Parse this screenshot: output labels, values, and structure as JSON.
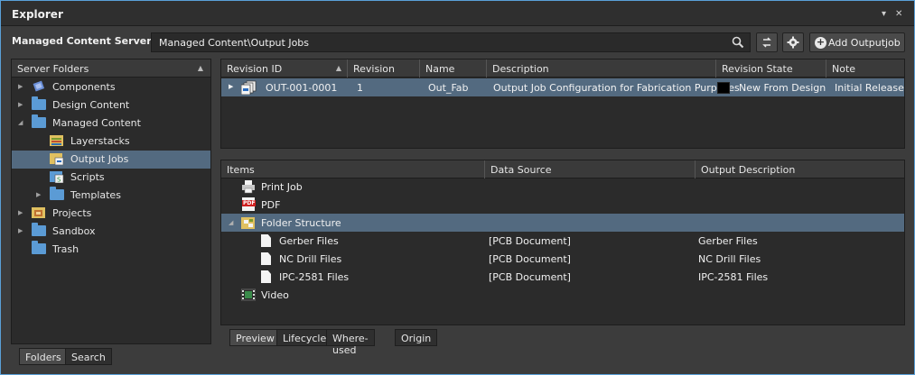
{
  "window": {
    "title": "Explorer",
    "pin_glyph": "▾",
    "close_glyph": "✕"
  },
  "toolbar": {
    "server_label": "Managed Content Server",
    "path_value": "Managed Content\\Output Jobs",
    "add_label": "Add Outputjob"
  },
  "left_panel": {
    "header": "Server Folders",
    "tree": [
      {
        "label": "Components",
        "icon": "components-icon",
        "expander": "▶",
        "level": 0
      },
      {
        "label": "Design Content",
        "icon": "folder-icon",
        "expander": "▶",
        "level": 0
      },
      {
        "label": "Managed Content",
        "icon": "folder-icon",
        "expander": "◢",
        "level": 0
      },
      {
        "label": "Layerstacks",
        "icon": "layerstack-folder-icon",
        "expander": "",
        "level": 1
      },
      {
        "label": "Output Jobs",
        "icon": "outputjob-folder-icon",
        "expander": "",
        "level": 1,
        "selected": true
      },
      {
        "label": "Scripts",
        "icon": "scripts-folder-icon",
        "expander": "",
        "level": 1
      },
      {
        "label": "Templates",
        "icon": "folder-icon",
        "expander": "▶",
        "level": 1
      },
      {
        "label": "Projects",
        "icon": "projects-folder-icon",
        "expander": "▶",
        "level": 0
      },
      {
        "label": "Sandbox",
        "icon": "folder-icon",
        "expander": "▶",
        "level": 0
      },
      {
        "label": "Trash",
        "icon": "folder-icon",
        "expander": "",
        "level": 0
      }
    ],
    "tabs": [
      "Folders",
      "Search"
    ]
  },
  "revisions": {
    "columns": [
      "Revision ID",
      "Revision",
      "Name",
      "Description",
      "Revision State",
      "Note"
    ],
    "row": {
      "revision_id": "OUT-001-0001",
      "revision": "1",
      "name": "Out_Fab",
      "description": "Output Job Configuration for Fabrication Purposes",
      "state": "New From Design",
      "note": "Initial Release",
      "state_color": "#000000"
    }
  },
  "items": {
    "columns": [
      "Items",
      "Data Source",
      "Output Description"
    ],
    "rows": [
      {
        "label": "Print Job",
        "source": "",
        "output": "",
        "icon": "printer-icon"
      },
      {
        "label": "PDF",
        "source": "",
        "output": "",
        "icon": "pdf-icon"
      },
      {
        "label": "Folder Structure",
        "source": "",
        "output": "",
        "icon": "folder-structure-icon",
        "expander": "◢"
      },
      {
        "label": "Gerber Files",
        "source": "[PCB Document]",
        "output": "Gerber Files",
        "icon": "document-icon"
      },
      {
        "label": "NC Drill Files",
        "source": "[PCB Document]",
        "output": "NC Drill Files",
        "icon": "document-icon"
      },
      {
        "label": "IPC-2581 Files",
        "source": "[PCB Document]",
        "output": "IPC-2581 Files",
        "icon": "document-icon"
      },
      {
        "label": "Video",
        "source": "",
        "output": "",
        "icon": "video-icon"
      }
    ],
    "tabs": [
      "Preview",
      "Lifecycle",
      "Where-used",
      "Origin"
    ]
  },
  "colors": {
    "selection": "#536a80",
    "accent_border": "#5aa0d8",
    "folder": "#5b9bd5"
  }
}
